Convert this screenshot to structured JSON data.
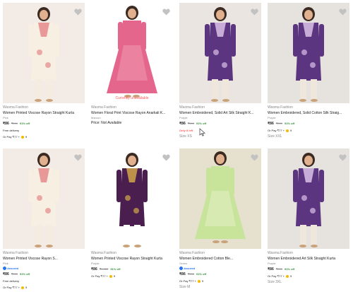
{
  "products": [
    {
      "brand": "Wasma Fashion",
      "title": "Women Printed Viscose Rayon Straight Kurta",
      "color": "Pink",
      "price": "₹86",
      "mrp": "₹999",
      "discount": "91% off",
      "delivery": "Free delivery",
      "pay": "Or Pay ₹77 +",
      "coins": "9",
      "image": {
        "bg": "#f3ece6",
        "garment": "#f6efe2",
        "accent": "#e58a8a",
        "bottom": "#f4ece0",
        "style": "kurta"
      }
    },
    {
      "brand": "Wasma Fashion",
      "title": "Women Floral Print Viscose Rayon Anarkali K...",
      "color": "Maroon",
      "price_text": "Price: Not Available",
      "unavailable": "Currently unavailable",
      "image": {
        "bg": "#ffffff",
        "garment": "#e5668c",
        "accent": "#f6b6c6",
        "bottom": "#e5668c",
        "style": "anarkali"
      }
    },
    {
      "brand": "Wasma Fashion",
      "title": "Women Embroidered, Solid Art Silk Straight K...",
      "color": "Purple",
      "price": "₹86",
      "mrp": "₹999",
      "discount": "91% off",
      "stock": "Only 8 left",
      "size": "Size XS",
      "image": {
        "bg": "#eae5e0",
        "garment": "#5b3580",
        "accent": "#d9c1e6",
        "bottom": "#efe7dc",
        "style": "kurta"
      }
    },
    {
      "brand": "Wasma Fashion",
      "title": "Women Embroidered, Solid Cotton Silk Straig...",
      "color": "Purple",
      "price": "₹86",
      "mrp": "₹999",
      "discount": "91% off",
      "pay": "Or Pay ₹77 +",
      "coins": "9",
      "size": "Size XXL",
      "image": {
        "bg": "#e6e2de",
        "garment": "#5b3580",
        "accent": "#d9c1e6",
        "bottom": "#efe7dc",
        "style": "kurta"
      }
    },
    {
      "brand": "Wasma Fashion",
      "title": "Women Printed Viscose Rayon S...",
      "color": "Pink",
      "assured": "Assured",
      "price": "₹86",
      "mrp": "₹999",
      "discount": "91% off",
      "delivery": "Free delivery",
      "pay": "Or Pay ₹77 +",
      "coins": "9",
      "image": {
        "bg": "#f3ece6",
        "garment": "#f6efe2",
        "accent": "#e58a8a",
        "bottom": "#f4ece0",
        "style": "kurta"
      }
    },
    {
      "brand": "Wasma Fashion",
      "title": "Women Printed Viscose Rayon Straight Kurta",
      "color": "Purple",
      "price": "₹86",
      "mrp": "₹1,022",
      "discount": "91% off",
      "pay": "Or Pay ₹77 +",
      "coins": "9",
      "image": {
        "bg": "#ffffff",
        "garment": "#4a1f4f",
        "accent": "#d2a64a",
        "bottom": "#ffffff",
        "style": "kurta"
      }
    },
    {
      "brand": "Wasma Fashion",
      "title": "Women Embroidered Cotton Ble...",
      "color": "Green",
      "assured": "Assured",
      "price": "₹86",
      "mrp": "₹999",
      "discount": "91% off",
      "pay": "Or Pay ₹77 +",
      "coins": "9",
      "size": "Size M",
      "image": {
        "bg": "#e6e0cf",
        "garment": "#c8e39a",
        "accent": "#f2f7df",
        "bottom": "#c8e39a",
        "style": "anarkali"
      }
    },
    {
      "brand": "Wasma Fashion",
      "title": "Women Embroidered Art Silk Straight Kurta",
      "color": "Purple",
      "price": "₹86",
      "mrp": "₹999",
      "discount": "91% off",
      "pay": "Or Pay ₹77 +",
      "coins": "9",
      "size": "Size 3XL",
      "image": {
        "bg": "#e6e2de",
        "garment": "#5b3580",
        "accent": "#d9c1e6",
        "bottom": "#efe7dc",
        "style": "kurta"
      }
    }
  ],
  "icons": {
    "wishlist": "heart-icon",
    "assured": "assured-badge-icon",
    "coin": "supercoin-icon",
    "cursor": "mouse-pointer-icon"
  }
}
